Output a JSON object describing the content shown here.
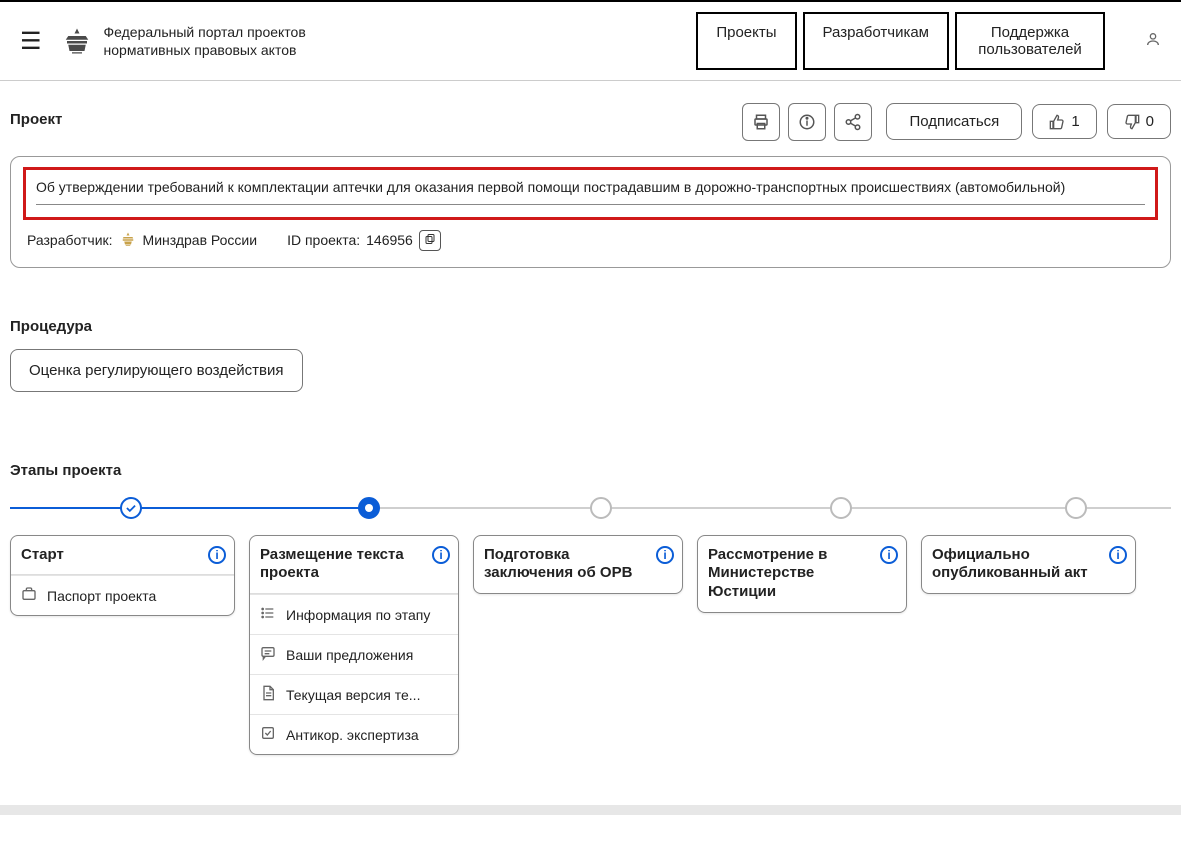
{
  "header": {
    "site_title_line1": "Федеральный портал проектов",
    "site_title_line2": "нормативных правовых актов",
    "nav": {
      "projects": "Проекты",
      "developers": "Разработчикам",
      "support": "Поддержка пользователей"
    }
  },
  "section": {
    "project_label": "Проект",
    "procedure_label": "Процедура",
    "stages_label": "Этапы проекта"
  },
  "actions": {
    "subscribe": "Подписаться",
    "likes": "1",
    "dislikes": "0"
  },
  "project": {
    "title": "Об утверждении требований к комплектации аптечки для оказания первой помощи пострадавшим в дорожно-транспортных происшествиях (автомобильной)",
    "developer_label": "Разработчик:",
    "developer_name": "Минздрав России",
    "id_label": "ID проекта:",
    "id_value": "146956"
  },
  "procedure": {
    "name": "Оценка регулирующего воздействия"
  },
  "stages": [
    {
      "title": "Старт",
      "items": [
        {
          "icon": "briefcase",
          "label": "Паспорт проекта"
        }
      ]
    },
    {
      "title": "Размещение текста проекта",
      "items": [
        {
          "icon": "list",
          "label": "Информация по этапу"
        },
        {
          "icon": "chat",
          "label": "Ваши предложения"
        },
        {
          "icon": "doc",
          "label": "Текущая версия те..."
        },
        {
          "icon": "shield",
          "label": "Антикор. экспертиза"
        }
      ]
    },
    {
      "title": "Подготовка заключения об ОРВ",
      "items": []
    },
    {
      "title": "Рассмотрение в Министерстве Юстиции",
      "items": []
    },
    {
      "title": "Официально опубликованный акт",
      "items": []
    }
  ]
}
